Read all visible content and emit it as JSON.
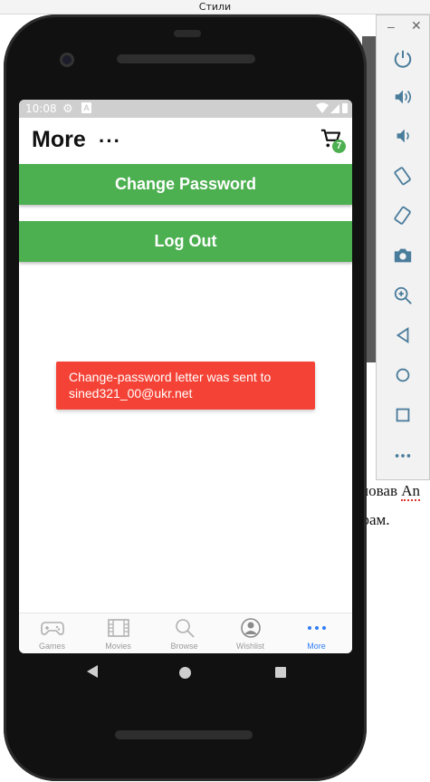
{
  "window": {
    "title": "Стили"
  },
  "background_document": {
    "line1_text": "новав",
    "line1_word": "An",
    "line2_text": "ограм."
  },
  "status_bar": {
    "time": "10:08"
  },
  "header": {
    "title": "More",
    "menu_label": "···",
    "cart_count": "7"
  },
  "buttons": {
    "change_password": "Change Password",
    "log_out": "Log Out"
  },
  "toast": {
    "message": "Change-password letter was sent to sined321_00@ukr.net"
  },
  "tabs": [
    {
      "label": "Games",
      "icon": "gamepad-icon",
      "active": false
    },
    {
      "label": "Movies",
      "icon": "film-icon",
      "active": false
    },
    {
      "label": "Browse",
      "icon": "search-icon",
      "active": false
    },
    {
      "label": "Wishlist",
      "icon": "user-icon",
      "active": false
    },
    {
      "label": "More",
      "icon": "more-dots-icon",
      "active": true
    }
  ],
  "colors": {
    "accent_green": "#4caf50",
    "toast_red": "#f44336",
    "active_tab_blue": "#2f7df6",
    "inactive_tab_gray": "#9a9a9a"
  },
  "emulator_panel": {
    "buttons": [
      "power-icon",
      "volume-up-icon",
      "volume-down-icon",
      "rotate-left-icon",
      "rotate-right-icon",
      "camera-icon",
      "zoom-icon",
      "back-icon",
      "home-icon",
      "overview-icon",
      "more-icon"
    ]
  }
}
